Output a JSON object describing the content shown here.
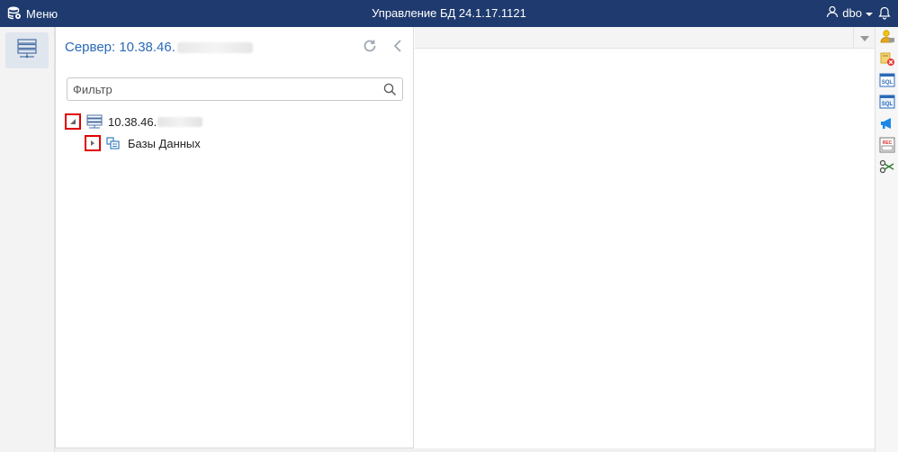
{
  "topbar": {
    "menu_label": "Меню",
    "title": "Управление БД 24.1.17.1121",
    "user_name": "dbo"
  },
  "left_rail": {
    "items": [
      {
        "icon": "server-list-icon",
        "active": true
      }
    ]
  },
  "panel": {
    "title_prefix": "Сервер: 10.38.46.",
    "filter_placeholder": "Фильтр",
    "tree": {
      "server_node": {
        "label": "10.38.46.",
        "expanded": true
      },
      "children": [
        {
          "label": "Базы Данных",
          "expanded": false
        }
      ]
    }
  },
  "right_tools": [
    "user-lock-icon",
    "backup-error-icon",
    "sql-icon",
    "sql-query-icon",
    "announce-icon",
    "record-icon",
    "cut-icon"
  ],
  "colors": {
    "topbar_bg": "#1e3a6e",
    "accent_blue": "#2a6ab8",
    "highlight_red": "#e00000"
  }
}
